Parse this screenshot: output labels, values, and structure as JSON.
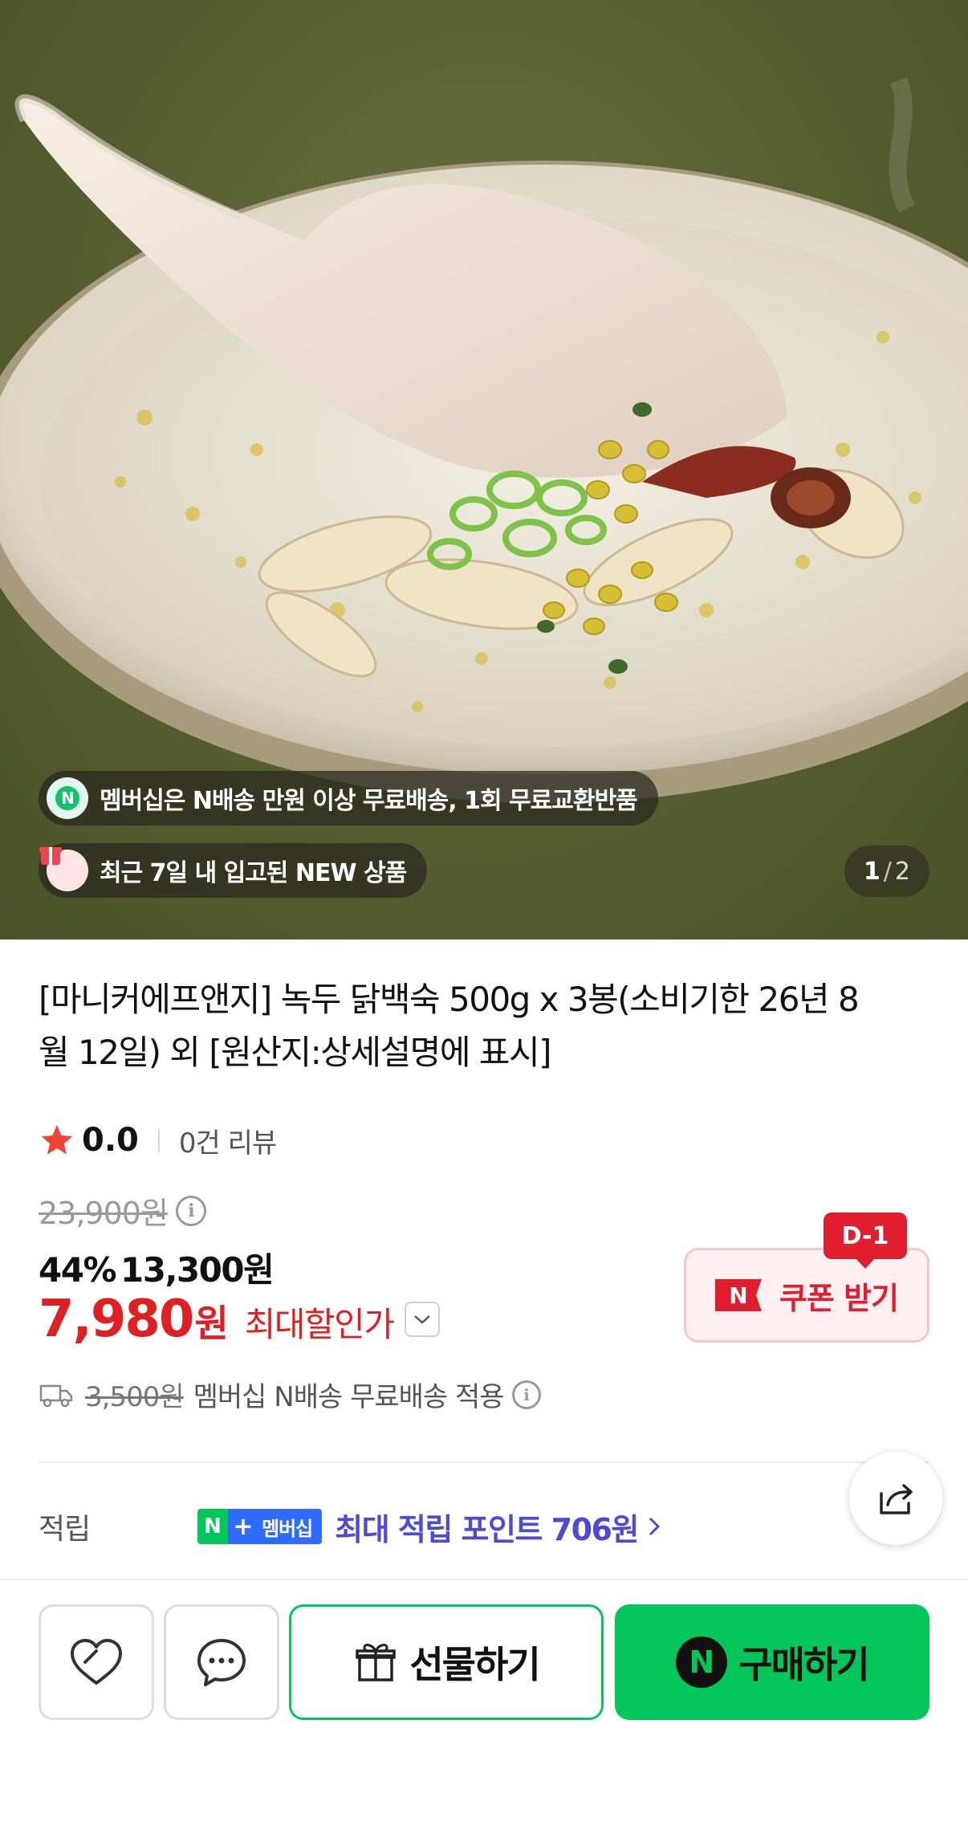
{
  "hero": {
    "banners": [
      {
        "icon": "n-membership-icon",
        "icon_text": "N",
        "text": "멤버십은 N배송 만원 이상 무료배송, 1회 무료교환반품"
      },
      {
        "icon": "new-box-icon",
        "text": "최근 7일 내 입고된 NEW 상품"
      }
    ],
    "counter": {
      "current": "1",
      "separator": "/",
      "total": "2"
    }
  },
  "product": {
    "title": "[마니커에프앤지] 녹두 닭백숙 500g x 3봉(소비기한 26년 8월 12일) 외 [원산지:상세설명에 표시]",
    "rating": {
      "value": "0.0",
      "reviews": "0건 리뷰"
    },
    "price": {
      "original": "23,900원",
      "discount_percent": "44%",
      "sale_price": "13,300원",
      "max_discount_value": "7,980",
      "max_discount_unit": "원",
      "max_discount_label": "최대할인가"
    },
    "coupon": {
      "badge": "D-1",
      "n_logo": "N",
      "label": "쿠폰 받기"
    },
    "shipping": {
      "fee": "3,500원",
      "text": "멤버십 N배송 무료배송 적용"
    },
    "points": {
      "label": "적립",
      "badge_n": "N",
      "badge_plus": "+",
      "badge_member": "멤버십",
      "text": "최대 적립 포인트 706원"
    }
  },
  "bottom_bar": {
    "gift_label": "선물하기",
    "buy_logo": "N",
    "buy_label": "구매하기"
  },
  "colors": {
    "naver_green": "#03c75a",
    "discount_red": "#e02020",
    "coupon_red": "#e01e30",
    "points_purple": "#4e49d6"
  }
}
